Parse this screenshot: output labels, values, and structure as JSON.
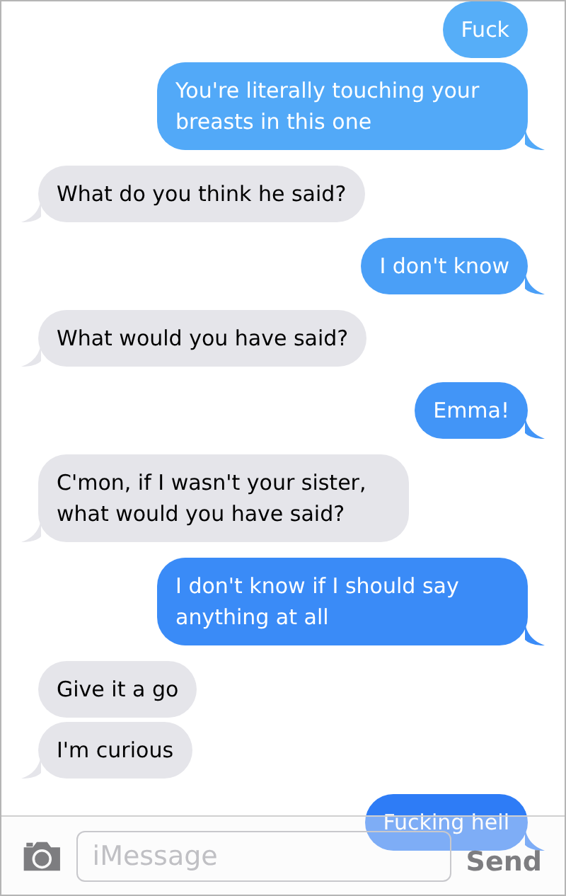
{
  "messages": [
    {
      "kind": "sent",
      "text": "Fuck"
    },
    {
      "kind": "sent",
      "text": "You're literally touching your breasts in this one"
    },
    {
      "kind": "received",
      "text": "What do you think he said?"
    },
    {
      "kind": "sent",
      "text": "I don't know"
    },
    {
      "kind": "received",
      "text": "What would you have said?"
    },
    {
      "kind": "sent",
      "text": "Emma!"
    },
    {
      "kind": "received",
      "text": "C'mon, if I wasn't your sister, what would you have said?"
    },
    {
      "kind": "sent",
      "text": "I don't know if I should say anything at all"
    },
    {
      "kind": "received",
      "text": "Give it a go"
    },
    {
      "kind": "received",
      "text": "I'm curious"
    },
    {
      "kind": "sent",
      "text": "Fucking hell"
    }
  ],
  "compose": {
    "placeholder": "iMessage",
    "send": "Send"
  }
}
